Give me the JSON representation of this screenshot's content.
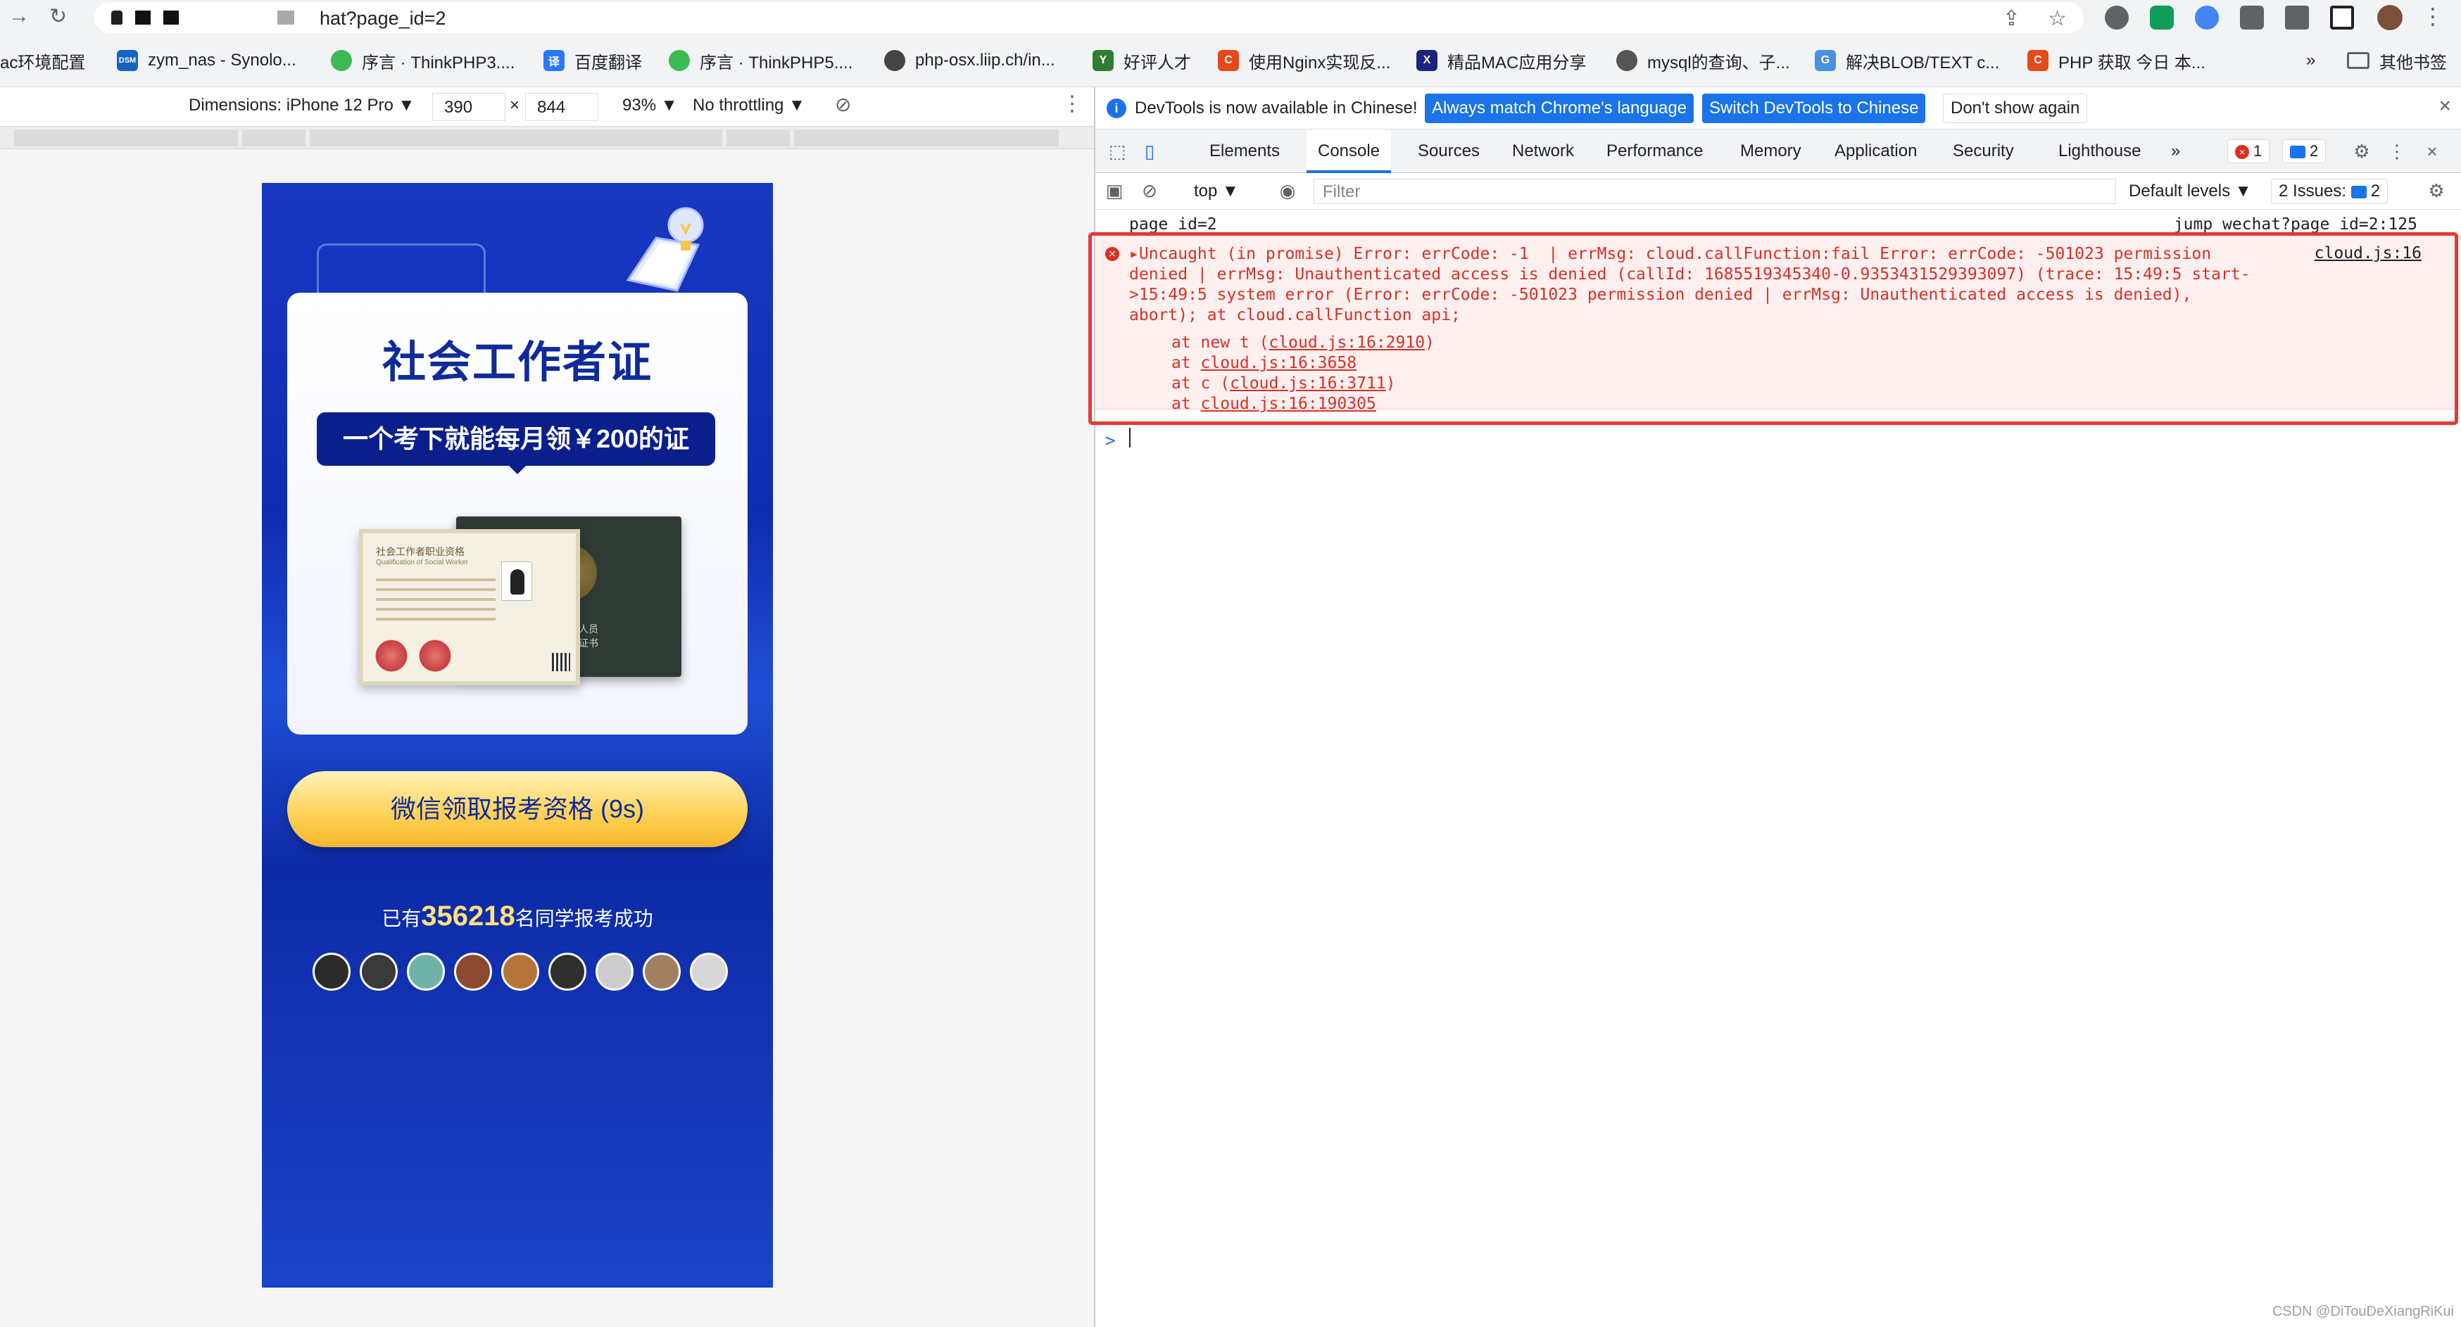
{
  "browser": {
    "url": "hat?page_id=2",
    "bookmarks": [
      {
        "label": "ac环境配置",
        "color": "#ffffff"
      },
      {
        "label": "zym_nas - Synolo...",
        "color": "#1565c0",
        "icon_text": "DSM"
      },
      {
        "label": "序言 · ThinkPHP3....",
        "color": "#3cba54"
      },
      {
        "label": "百度翻译",
        "color": "#2979ff",
        "icon_text": "译"
      },
      {
        "label": "序言 · ThinkPHP5....",
        "color": "#3cba54"
      },
      {
        "label": "php-osx.liip.ch/in...",
        "color": "#444444"
      },
      {
        "label": "好评人才",
        "color": "#2e7d32",
        "icon_text": "Y"
      },
      {
        "label": "使用Nginx实现反...",
        "color": "#e64a19",
        "icon_text": "C"
      },
      {
        "label": "精品MAC应用分享",
        "color": "#1a237e",
        "icon_text": "X"
      },
      {
        "label": "mysql的查询、子...",
        "color": "#555555"
      },
      {
        "label": "解决BLOB/TEXT c...",
        "color": "#4a90e2",
        "icon_text": "G"
      },
      {
        "label": "PHP 获取 今日 本...",
        "color": "#e64a19",
        "icon_text": "C"
      }
    ],
    "bookmarks_overflow": "»",
    "other_bookmarks": "其他书签"
  },
  "device_toolbar": {
    "dimensions_label": "Dimensions: iPhone 12 Pro ▼",
    "width": "390",
    "times": "×",
    "height": "844",
    "zoom": "93% ▼",
    "throttling": "No throttling ▼"
  },
  "phone_page": {
    "title": "社会工作者证",
    "tagline": "一个考下就能每月领￥200的证",
    "cert_left_label": "社会工作者职业资格",
    "cert_left_sub": "Qualification of Social Worker",
    "cert_right_text": "专业技术人员\n职业资格证书",
    "cta": "微信领取报考资格 (9s)",
    "count_prefix": "已有",
    "count_value": "356218",
    "count_suffix": "名同学报考成功",
    "avatar_colors": [
      "#2b2b2b",
      "#3a3a3a",
      "#6fb3a8",
      "#8b4a2f",
      "#b4743a",
      "#2f2f2f",
      "#cccccc",
      "#a08060",
      "#d8d8d8"
    ]
  },
  "devtools": {
    "infobar": {
      "message": "DevTools is now available in Chinese!",
      "btn_match": "Always match Chrome's language",
      "btn_switch": "Switch DevTools to Chinese",
      "btn_dismiss": "Don't show again"
    },
    "tabs": [
      "Elements",
      "Console",
      "Sources",
      "Network",
      "Performance",
      "Memory",
      "Application",
      "Security",
      "Lighthouse"
    ],
    "active_tab": "Console",
    "more_tabs": "»",
    "error_count": "1",
    "message_count": "2",
    "context": "top ▼",
    "filter_placeholder": "Filter",
    "levels": "Default levels ▼",
    "issues_label": "2 Issues:",
    "issues_count": "2",
    "log": {
      "text": "page_id=2",
      "source": "jump_wechat?page_id=2:125"
    },
    "error": {
      "message": "▸Uncaught (in promise) Error: errCode: -1  | errMsg: cloud.callFunction:fail Error: errCode: -501023 permission denied | errMsg: Unauthenticated access is denied (callId: 1685519345340-0.9353431529393097) (trace: 15:49:5 start->15:49:5 system error (Error: errCode: -501023 permission denied | errMsg: Unauthenticated access is denied), abort); at cloud.callFunction api;",
      "source": "cloud.js:16",
      "stack": [
        {
          "prefix": "at new t (",
          "link": "cloud.js:16:2910",
          "suffix": ")"
        },
        {
          "prefix": "at ",
          "link": "cloud.js:16:3658",
          "suffix": ""
        },
        {
          "prefix": "at c (",
          "link": "cloud.js:16:3711",
          "suffix": ")"
        },
        {
          "prefix": "at ",
          "link": "cloud.js:16:190305",
          "suffix": ""
        }
      ]
    },
    "prompt": ">"
  },
  "watermark": "CSDN @DiTouDeXiangRiKui",
  "colors": {
    "accent": "#1a73e8",
    "error": "#d93025",
    "highlight_outline": "#e53935",
    "phone_blue": "#0f2bb0",
    "cta_gold": "#ffd35a"
  }
}
